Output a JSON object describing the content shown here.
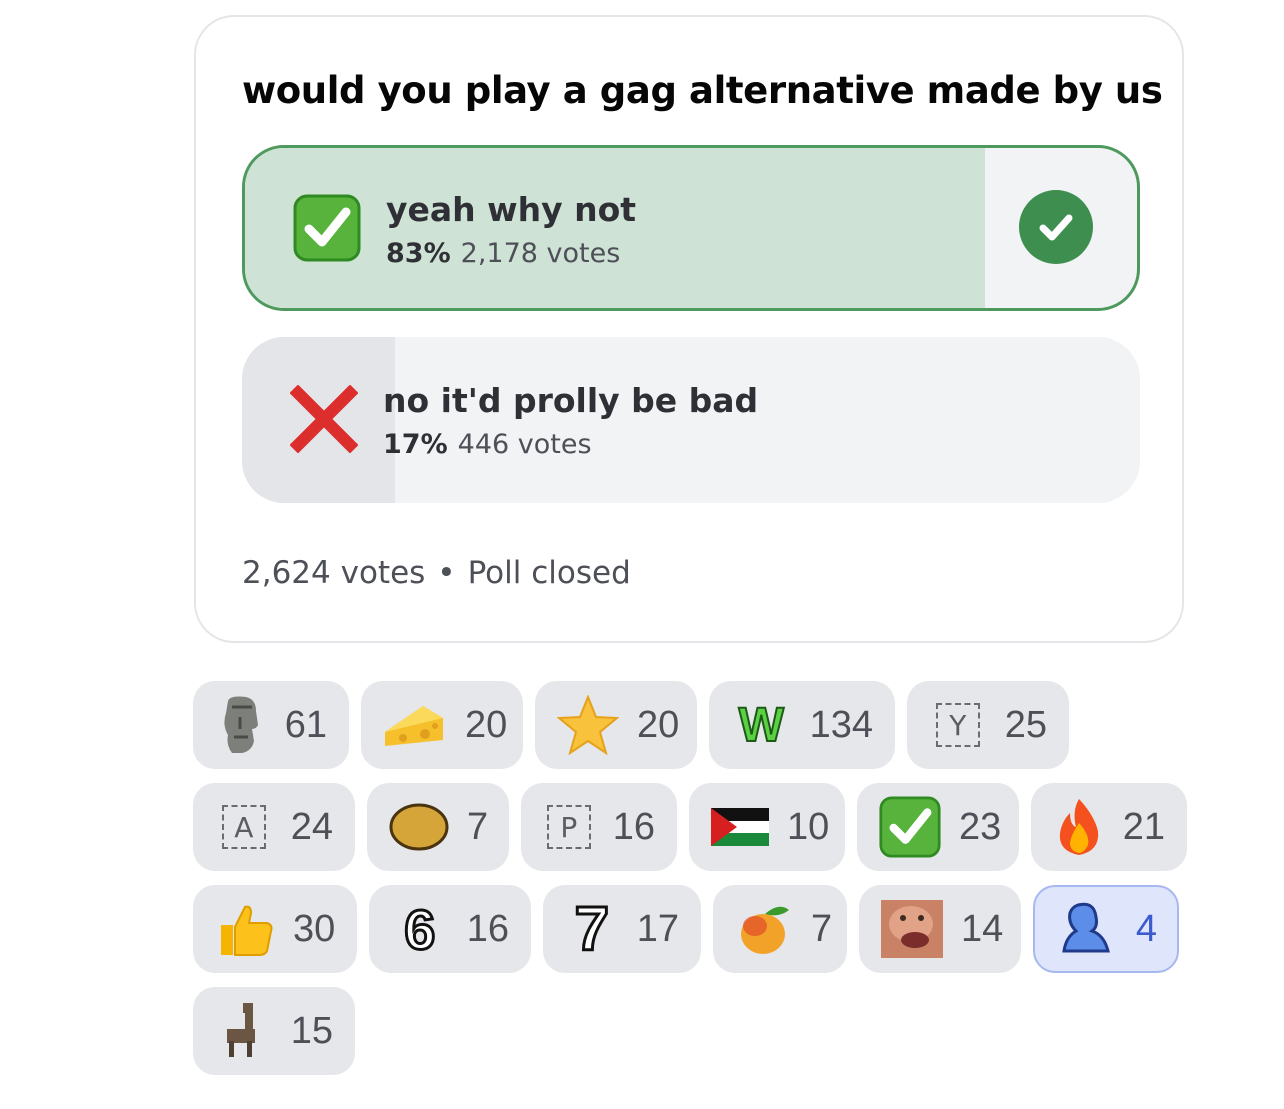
{
  "poll": {
    "question": "would you play a gag alternative made by us",
    "options": [
      {
        "label": "yeah why not",
        "percent": "83%",
        "votes": "2,178 votes",
        "share": 0.83,
        "emoji": "check-mark-button-icon",
        "winner": true
      },
      {
        "label": "no it'd prolly be bad",
        "percent": "17%",
        "votes": "446 votes",
        "share": 0.17,
        "emoji": "cross-mark-icon",
        "winner": false
      }
    ],
    "total_votes": "2,624 votes",
    "separator": "•",
    "status": "Poll closed"
  },
  "reactions": [
    {
      "icon": "moai-icon",
      "count": "61"
    },
    {
      "icon": "cheese-icon",
      "count": "20"
    },
    {
      "icon": "star-icon",
      "count": "20"
    },
    {
      "icon": "w-emoji-icon",
      "count": "134",
      "glyph": "W"
    },
    {
      "icon": "letter-y-icon",
      "count": "25",
      "glyph": "Y"
    },
    {
      "icon": "letter-a-icon",
      "count": "24",
      "glyph": "A"
    },
    {
      "icon": "coin-icon",
      "count": "7"
    },
    {
      "icon": "letter-p-icon",
      "count": "16",
      "glyph": "P"
    },
    {
      "icon": "palestine-flag-icon",
      "count": "10"
    },
    {
      "icon": "check-mark-button-icon",
      "count": "23"
    },
    {
      "icon": "fire-icon",
      "count": "21"
    },
    {
      "icon": "thumbs-up-icon",
      "count": "30"
    },
    {
      "icon": "number-six-icon",
      "count": "16",
      "glyph": "6"
    },
    {
      "icon": "number-seven-icon",
      "count": "17",
      "glyph": "7"
    },
    {
      "icon": "mango-icon",
      "count": "7"
    },
    {
      "icon": "face-meme-icon",
      "count": "14"
    },
    {
      "icon": "blue-figure-icon",
      "count": "4",
      "me": true
    },
    {
      "icon": "llama-icon",
      "count": "15"
    }
  ],
  "colors": {
    "winner_border": "#4e9a5e",
    "winner_fill": "#cfe2d6",
    "loser_fill": "#e3e5e8",
    "check_circle": "#3e8e50",
    "my_reaction": "#dfe5fb"
  }
}
